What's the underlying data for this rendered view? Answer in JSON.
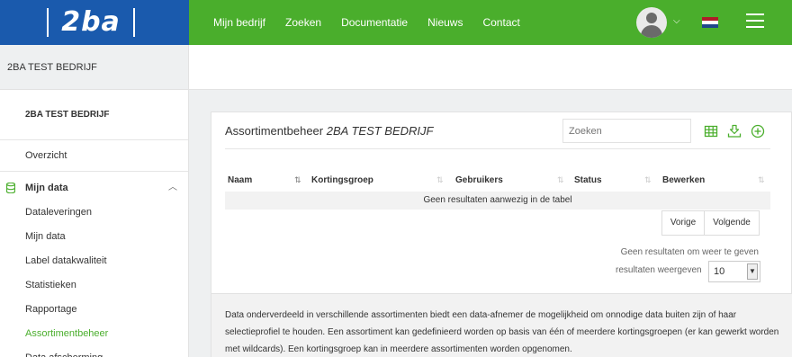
{
  "header": {
    "logo_text": "2ba",
    "nav": [
      "Mijn bedrijf",
      "Zoeken",
      "Documentatie",
      "Nieuws",
      "Contact"
    ],
    "caret": "⌵",
    "colors": {
      "green": "#4aae2c",
      "blue": "#1a5aad"
    }
  },
  "sidebar": {
    "company_top": "2BA TEST BEDRIJF",
    "company_bold": "2BA TEST BEDRIJF",
    "overview": "Overzicht",
    "group_label": "Mijn data",
    "group_chevron": "︿",
    "items": [
      "Dataleveringen",
      "Mijn data",
      "Label datakwaliteit",
      "Statistieken",
      "Rapportage",
      "Assortimentbeheer",
      "Data afscherming"
    ],
    "active_item": "Assortimentbeheer"
  },
  "panel": {
    "title": "Assortimentbeheer",
    "title_company": "2BA TEST BEDRIJF",
    "search_placeholder": "Zoeken",
    "columns": [
      "Naam",
      "Kortingsgroep",
      "Gebruikers",
      "Status",
      "Bewerken"
    ],
    "empty_message": "Geen resultaten aanwezig in de tabel",
    "prev_label": "Vorige",
    "next_label": "Volgende",
    "info_results": "Geen resultaten om weer te geven",
    "info_per_page": "resultaten weergeven",
    "per_page_value": "10",
    "description": "Data onderverdeeld in verschillende assortimenten biedt een data-afnemer de mogelijkheid om onnodige data buiten zijn of haar selectieprofiel te houden. Een assortiment kan gedefinieerd worden op basis van één of meerdere kortingsgroepen (er kan gewerkt worden met wildcards). Een kortingsgroep kan in meerdere assortimenten worden opgenomen."
  }
}
